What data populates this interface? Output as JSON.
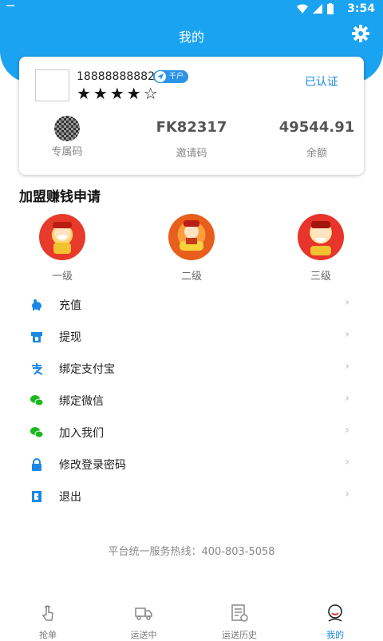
{
  "status_bar": {
    "time": "3:54",
    "battery_text": "",
    "colors": {
      "background": "#1aa3f0"
    }
  },
  "header": {
    "title": "我的",
    "settings_icon": "gear-icon"
  },
  "profile": {
    "phone": "18888888882",
    "badge": "千户",
    "stars": "★★★★☆",
    "rating": 4,
    "rating_max": 5,
    "verified": "已认证",
    "stats": [
      {
        "value": "",
        "label": "专属码",
        "icon": "qr-code-icon"
      },
      {
        "value": "FK82317",
        "label": "邀请码"
      },
      {
        "value": "49544.91",
        "label": "余额"
      }
    ]
  },
  "section_title": "加盟赚钱申请",
  "levels": [
    {
      "label": "一级",
      "icon": "fortune-god-icon"
    },
    {
      "label": "二级",
      "icon": "fortune-god-icon"
    },
    {
      "label": "三级",
      "icon": "fortune-god-icon"
    }
  ],
  "menu": [
    {
      "label": "充值",
      "icon": "piggy-bank-icon",
      "color": "#1a89e6"
    },
    {
      "label": "提现",
      "icon": "withdraw-icon",
      "color": "#1a89e6"
    },
    {
      "label": "绑定支付宝",
      "icon": "alipay-icon",
      "color": "#1a89e6"
    },
    {
      "label": "绑定微信",
      "icon": "wechat-icon",
      "color": "#19b91c"
    },
    {
      "label": "加入我们",
      "icon": "wechat-icon",
      "color": "#19b91c"
    },
    {
      "label": "修改登录密码",
      "icon": "lock-icon",
      "color": "#1a89e6"
    },
    {
      "label": "退出",
      "icon": "exit-icon",
      "color": "#1a89e6"
    }
  ],
  "chevron": "›",
  "hotline": "平台统一服务热线：400-803-5058",
  "tabs": [
    {
      "label": "抢单",
      "icon": "hand-tap-icon",
      "active": false
    },
    {
      "label": "运送中",
      "icon": "truck-icon",
      "active": false
    },
    {
      "label": "运送历史",
      "icon": "history-icon",
      "active": false
    },
    {
      "label": "我的",
      "icon": "profile-icon",
      "active": true
    }
  ],
  "colors": {
    "accent": "#1aa3f0",
    "link": "#1a89e6",
    "wechat": "#19b91c"
  }
}
